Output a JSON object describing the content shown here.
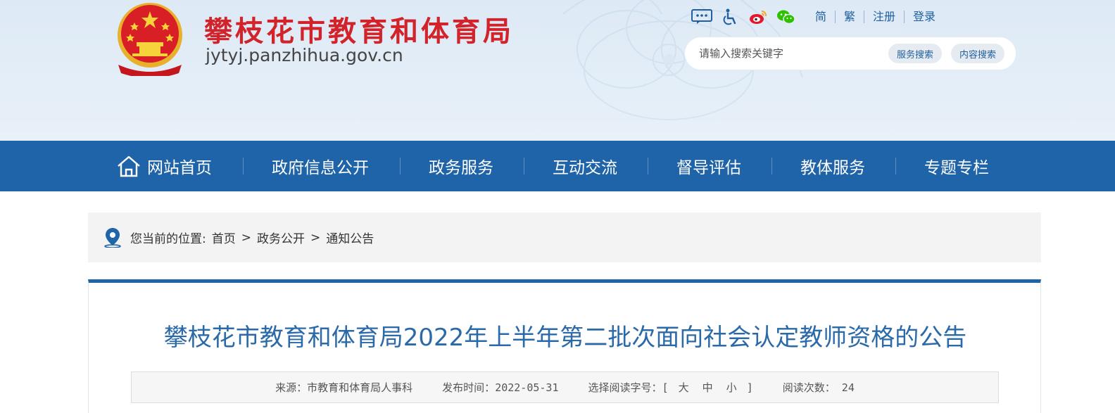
{
  "header": {
    "title": "攀枝花市教育和体育局",
    "domain": "jytyj.panzhihua.gov.cn"
  },
  "toolbar": {
    "icons": [
      "message-icon",
      "accessibility-icon",
      "weibo-icon",
      "wechat-icon"
    ],
    "links": [
      "简",
      "繁",
      "注册",
      "登录"
    ]
  },
  "search": {
    "placeholder": "请输入搜索关键字",
    "service_button": "服务搜索",
    "content_button": "内容搜索"
  },
  "nav": {
    "items": [
      "网站首页",
      "政府信息公开",
      "政务服务",
      "互动交流",
      "督导评估",
      "教体服务",
      "专题专栏"
    ]
  },
  "breadcrumb": {
    "label": "您当前的位置:",
    "items": [
      "首页",
      "政务公开",
      "通知公告"
    ],
    "separator": ">"
  },
  "article": {
    "title": "攀枝花市教育和体育局2022年上半年第二批次面向社会认定教师资格的公告",
    "source_label": "来源：",
    "source": "市教育和体育局人事科",
    "date_label": "发布时间：",
    "date": "2022-05-31",
    "font_label": "选择阅读字号：",
    "font_open": "[",
    "font_sizes": [
      "大",
      "中",
      "小"
    ],
    "font_close": "]",
    "views_label": "阅读次数：",
    "views": "24"
  },
  "colors": {
    "brand_blue": "#1f64a8",
    "title_red": "#d2232a",
    "article_title": "#2b6aa8"
  }
}
